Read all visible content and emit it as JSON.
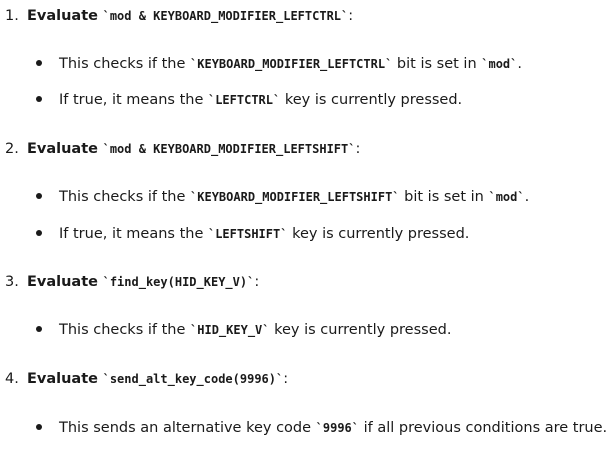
{
  "steps": [
    {
      "number": "1.",
      "label": "Evaluate",
      "code": "`mod & KEYBOARD_MODIFIER_LEFTCTRL`",
      "suffix": ":",
      "bullets": [
        {
          "pre": "This checks if the ",
          "code": "`KEYBOARD_MODIFIER_LEFTCTRL`",
          "mid": " bit is set in ",
          "code2": "`mod`",
          "post": "."
        },
        {
          "pre": "If true, it means the ",
          "code": "`LEFTCTRL`",
          "mid": " key is currently pressed.",
          "code2": "",
          "post": ""
        }
      ]
    },
    {
      "number": "2.",
      "label": "Evaluate",
      "code": "`mod & KEYBOARD_MODIFIER_LEFTSHIFT`",
      "suffix": ":",
      "bullets": [
        {
          "pre": "This checks if the ",
          "code": "`KEYBOARD_MODIFIER_LEFTSHIFT`",
          "mid": " bit is set in ",
          "code2": "`mod`",
          "post": "."
        },
        {
          "pre": "If true, it means the ",
          "code": "`LEFTSHIFT`",
          "mid": " key is currently pressed.",
          "code2": "",
          "post": ""
        }
      ]
    },
    {
      "number": "3.",
      "label": "Evaluate",
      "code": "`find_key(HID_KEY_V)`",
      "suffix": ":",
      "bullets": [
        {
          "pre": "This checks if the ",
          "code": "`HID_KEY_V`",
          "mid": " key is currently pressed.",
          "code2": "",
          "post": ""
        }
      ]
    },
    {
      "number": "4.",
      "label": "Evaluate",
      "code": "`send_alt_key_code(9996)`",
      "suffix": ":",
      "bullets": [
        {
          "pre": "This sends an alternative key code ",
          "code": "`9996`",
          "mid": " if all previous conditions are true.",
          "code2": "",
          "post": ""
        }
      ]
    }
  ]
}
